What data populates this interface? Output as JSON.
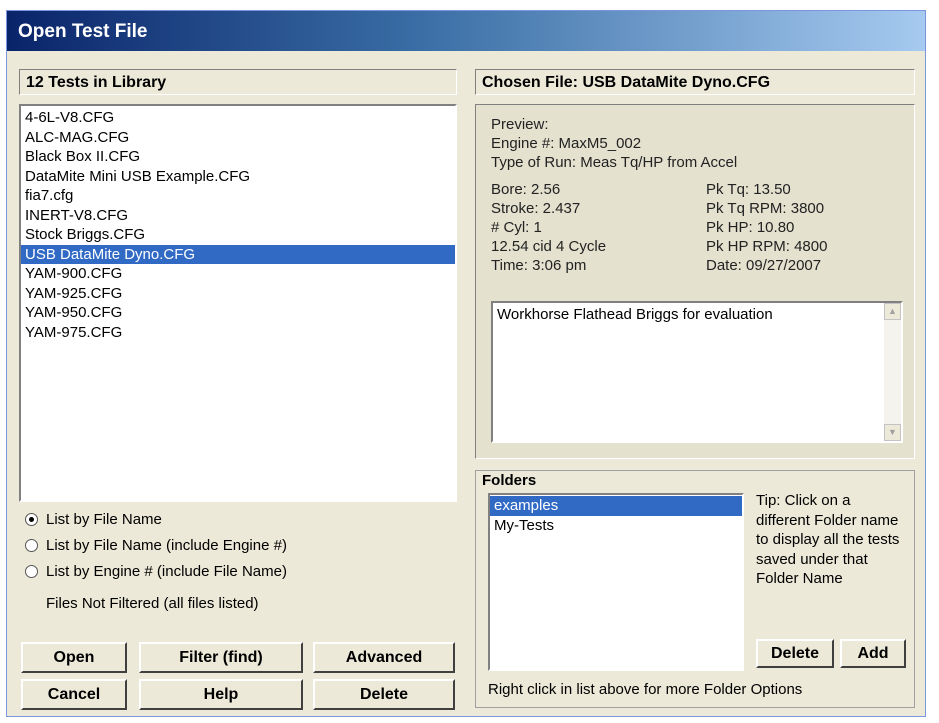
{
  "window": {
    "title": "Open Test File"
  },
  "library": {
    "header": "12 Tests in Library",
    "files": [
      "4-6L-V8.CFG",
      "ALC-MAG.CFG",
      "Black Box II.CFG",
      "DataMite Mini USB Example.CFG",
      "fia7.cfg",
      "INERT-V8.CFG",
      "Stock Briggs.CFG",
      "USB DataMite Dyno.CFG",
      "YAM-900.CFG",
      "YAM-925.CFG",
      "YAM-950.CFG",
      "YAM-975.CFG"
    ],
    "selected": "USB DataMite Dyno.CFG"
  },
  "chosen": {
    "header": "Chosen File: USB DataMite Dyno.CFG",
    "preview_label": "Preview:",
    "engine": "Engine #: MaxM5_002",
    "run_type": "Type of Run: Meas Tq/HP from Accel",
    "bore": "Bore: 2.56",
    "stroke": "Stroke: 2.437",
    "cyl": "# Cyl: 1",
    "cid": "12.54 cid  4 Cycle",
    "time": "Time: 3:06 pm",
    "pk_tq": "Pk Tq: 13.50",
    "pk_tq_rpm": "Pk Tq RPM:  3800",
    "pk_hp": "Pk HP: 10.80",
    "pk_hp_rpm": "Pk HP RPM:  4800",
    "date": "Date: 09/27/2007",
    "notes": "Workhorse Flathead Briggs for evaluation"
  },
  "list_options": {
    "options": [
      "List by File Name",
      "List by File Name (include Engine #)",
      "List by Engine # (include File Name)"
    ],
    "selected_index": 0,
    "filter_status": "Files Not Filtered (all files listed)"
  },
  "buttons": {
    "open": "Open",
    "filter": "Filter (find)",
    "advanced": "Advanced",
    "cancel": "Cancel",
    "help": "Help",
    "delete": "Delete"
  },
  "folders": {
    "label": "Folders",
    "items": [
      "examples",
      "My-Tests"
    ],
    "selected": "examples",
    "tip": "Tip:  Click on a different Folder name to display all the tests saved under that Folder Name",
    "delete_label": "Delete",
    "add_label": "Add",
    "footer": "Right click in list above for more Folder Options"
  }
}
